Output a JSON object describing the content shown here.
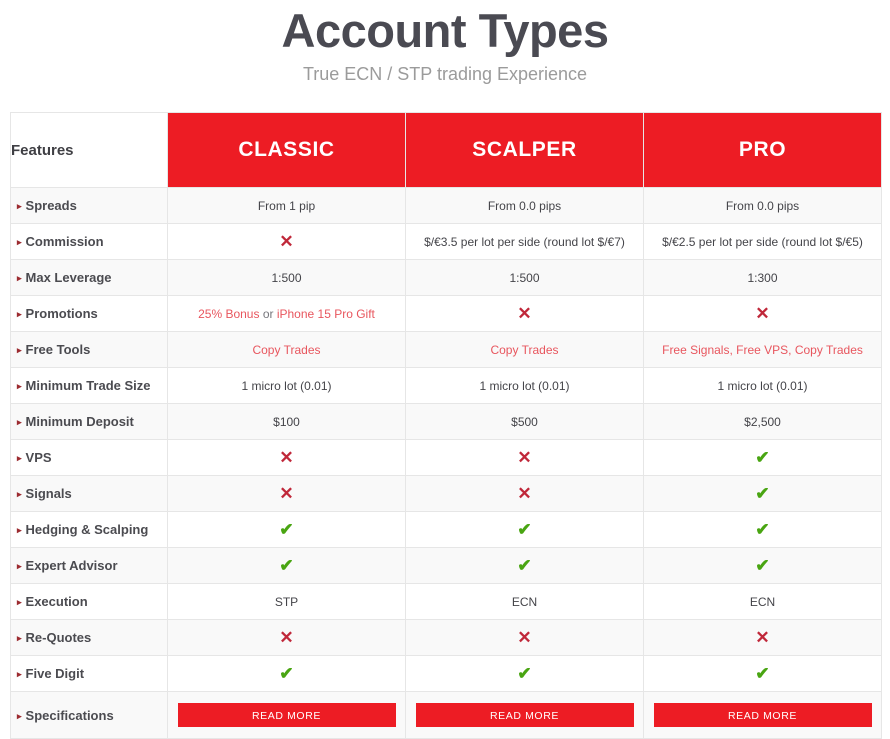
{
  "header": {
    "title": "Account Types",
    "subtitle": "True ECN / STP trading Experience"
  },
  "colors": {
    "brand_red": "#ed1c24",
    "link_red": "#e8565e",
    "check_green": "#49a512",
    "cross_red": "#c0283a",
    "title_gray": "#4a4a52",
    "subtitle_gray": "#9b9b9b",
    "row_alt": "#f9f9f9",
    "border": "#e6e6e6"
  },
  "table": {
    "feature_header": "Features",
    "plans": [
      "CLASSIC",
      "SCALPER",
      "PRO"
    ],
    "rows": [
      {
        "feature": "Spreads",
        "cells": [
          {
            "kind": "text",
            "text": "From 1 pip"
          },
          {
            "kind": "text",
            "text": "From 0.0 pips"
          },
          {
            "kind": "text",
            "text": "From 0.0 pips"
          }
        ]
      },
      {
        "feature": "Commission",
        "cells": [
          {
            "kind": "cross",
            "text": "✕"
          },
          {
            "kind": "text",
            "text": "$/€3.5 per lot per side (round lot $/€7)"
          },
          {
            "kind": "text",
            "text": "$/€2.5 per lot per side (round lot $/€5)"
          }
        ]
      },
      {
        "feature": "Max Leverage",
        "cells": [
          {
            "kind": "text",
            "text": "1:500"
          },
          {
            "kind": "text",
            "text": "1:500"
          },
          {
            "kind": "text",
            "text": "1:300"
          }
        ]
      },
      {
        "feature": "Promotions",
        "cells": [
          {
            "kind": "promo",
            "link1": "25% Bonus",
            "sep": " or ",
            "link2": "iPhone 15 Pro Gift"
          },
          {
            "kind": "cross",
            "text": "✕"
          },
          {
            "kind": "cross",
            "text": "✕"
          }
        ]
      },
      {
        "feature": "Free Tools",
        "cells": [
          {
            "kind": "link",
            "text": "Copy Trades"
          },
          {
            "kind": "link",
            "text": "Copy Trades"
          },
          {
            "kind": "link",
            "text": "Free Signals, Free VPS, Copy Trades"
          }
        ]
      },
      {
        "feature": "Minimum Trade Size",
        "cells": [
          {
            "kind": "text",
            "text": "1 micro lot (0.01)"
          },
          {
            "kind": "text",
            "text": "1 micro lot (0.01)"
          },
          {
            "kind": "text",
            "text": "1 micro lot (0.01)"
          }
        ]
      },
      {
        "feature": "Minimum Deposit",
        "cells": [
          {
            "kind": "text",
            "text": "$100"
          },
          {
            "kind": "text",
            "text": "$500"
          },
          {
            "kind": "text",
            "text": "$2,500"
          }
        ]
      },
      {
        "feature": "VPS",
        "cells": [
          {
            "kind": "cross",
            "text": "✕"
          },
          {
            "kind": "cross",
            "text": "✕"
          },
          {
            "kind": "check",
            "text": "✔"
          }
        ]
      },
      {
        "feature": "Signals",
        "cells": [
          {
            "kind": "cross",
            "text": "✕"
          },
          {
            "kind": "cross",
            "text": "✕"
          },
          {
            "kind": "check",
            "text": "✔"
          }
        ]
      },
      {
        "feature": "Hedging & Scalping",
        "cells": [
          {
            "kind": "check",
            "text": "✔"
          },
          {
            "kind": "check",
            "text": "✔"
          },
          {
            "kind": "check",
            "text": "✔"
          }
        ]
      },
      {
        "feature": "Expert Advisor",
        "cells": [
          {
            "kind": "check",
            "text": "✔"
          },
          {
            "kind": "check",
            "text": "✔"
          },
          {
            "kind": "check",
            "text": "✔"
          }
        ]
      },
      {
        "feature": "Execution",
        "cells": [
          {
            "kind": "text",
            "text": "STP"
          },
          {
            "kind": "text",
            "text": "ECN"
          },
          {
            "kind": "text",
            "text": "ECN"
          }
        ]
      },
      {
        "feature": "Re-Quotes",
        "cells": [
          {
            "kind": "cross",
            "text": "✕"
          },
          {
            "kind": "cross",
            "text": "✕"
          },
          {
            "kind": "cross",
            "text": "✕"
          }
        ]
      },
      {
        "feature": "Five Digit",
        "cells": [
          {
            "kind": "check",
            "text": "✔"
          },
          {
            "kind": "check",
            "text": "✔"
          },
          {
            "kind": "check",
            "text": "✔"
          }
        ]
      },
      {
        "feature": "Specifications",
        "cells": [
          {
            "kind": "button",
            "text": "READ MORE"
          },
          {
            "kind": "button",
            "text": "READ MORE"
          },
          {
            "kind": "button",
            "text": "READ MORE"
          }
        ]
      }
    ]
  }
}
